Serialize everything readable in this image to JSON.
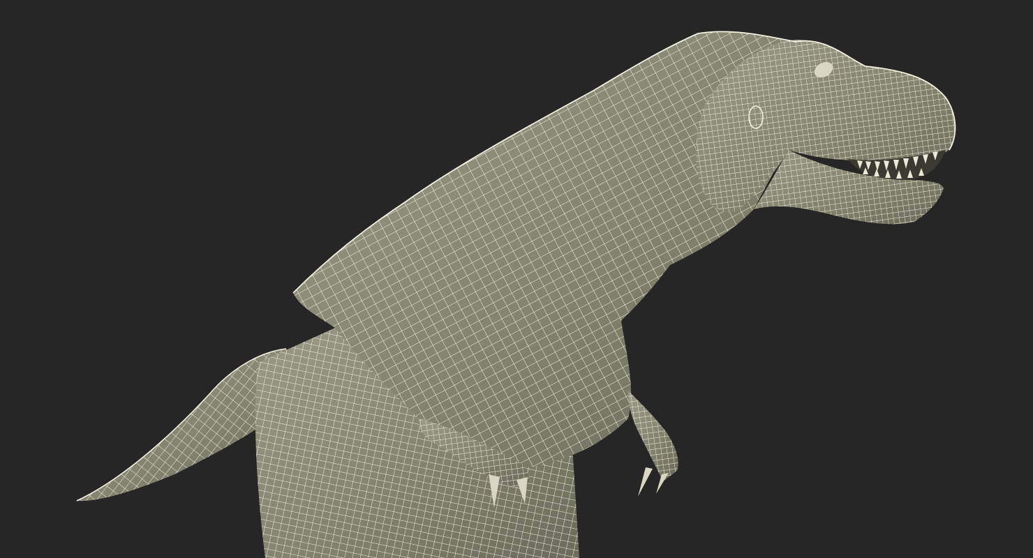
{
  "scene": {
    "subject": "t-rex-wireframe-model",
    "render_mode": "wireframe-over-shaded",
    "colors": {
      "background": "#262626",
      "body_fill": "#83836f",
      "body_fill_light": "#9a9a86",
      "body_fill_dark": "#6b6b5b",
      "wire": "#f4f2e2",
      "mouth_dark": "#3a3a33",
      "teeth": "#ece9d6"
    }
  }
}
